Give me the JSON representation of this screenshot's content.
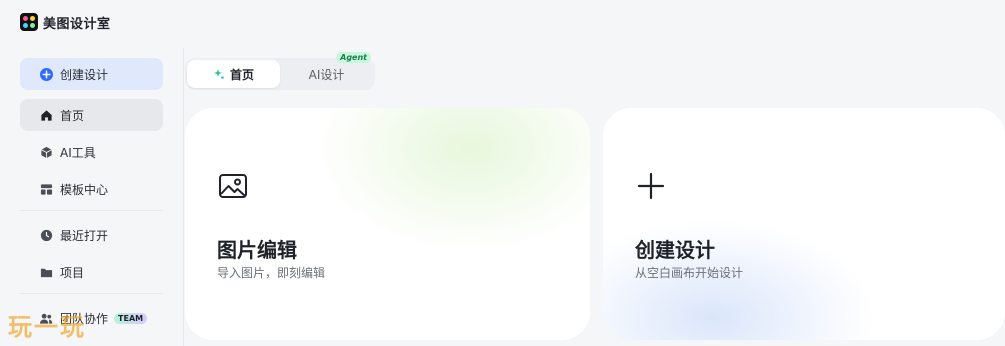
{
  "app": {
    "title": "美图设计室"
  },
  "sidebar": {
    "create_label": "创建设计",
    "items": [
      {
        "label": "首页",
        "icon": "home-icon"
      },
      {
        "label": "AI工具",
        "icon": "cube-icon"
      },
      {
        "label": "模板中心",
        "icon": "template-icon"
      },
      {
        "label": "最近打开",
        "icon": "clock-icon"
      },
      {
        "label": "项目",
        "icon": "folder-icon"
      },
      {
        "label": "团队协作",
        "icon": "team-icon",
        "badge": "TEAM"
      }
    ]
  },
  "tabs": [
    {
      "label": "首页",
      "active": true
    },
    {
      "label": "AI设计",
      "tag": "Agent"
    }
  ],
  "cards": [
    {
      "title": "图片编辑",
      "subtitle": "导入图片，即刻编辑",
      "icon": "image-icon"
    },
    {
      "title": "创建设计",
      "subtitle": "从空白画布开始设计",
      "icon": "plus-icon"
    }
  ],
  "watermark": "玩一玩",
  "colors": {
    "create_bg": "#dfe9fb",
    "accent_blue": "#2f6bff",
    "active_bg": "#e6e8eb"
  }
}
